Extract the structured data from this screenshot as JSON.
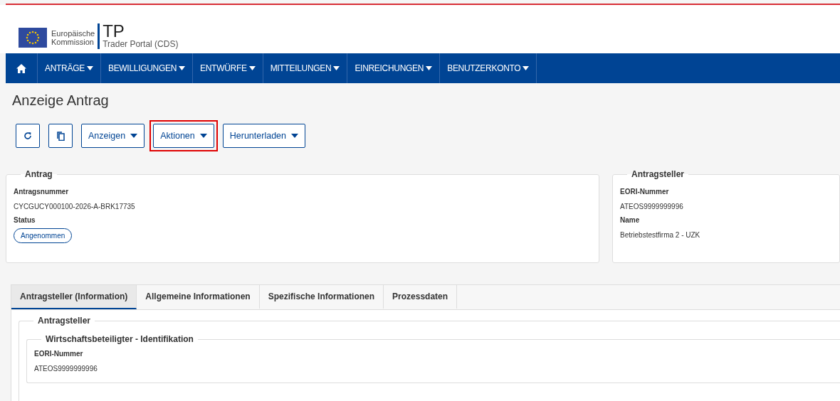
{
  "header": {
    "logo_line_1": "Europäische",
    "logo_line_2": "Kommission",
    "app_name": "TP",
    "app_subtitle": "Trader Portal (CDS)"
  },
  "nav": [
    {
      "label": "ANTRÄGE",
      "kind": "dropdown"
    },
    {
      "label": "BEWILLIGUNGEN",
      "kind": "dropdown"
    },
    {
      "label": "ENTWÜRFE",
      "kind": "dropdown"
    },
    {
      "label": "MITTEILUNGEN",
      "kind": "dropdown"
    },
    {
      "label": "EINREICHUNGEN",
      "kind": "dropdown"
    },
    {
      "label": "BENUTZERKONTO",
      "kind": "dropdown"
    }
  ],
  "page_title": "Anzeige Antrag",
  "toolbar": [
    {
      "kind": "refresh",
      "highlighted": false
    },
    {
      "kind": "copy",
      "highlighted": false
    },
    {
      "kind": "dropdown",
      "label": "Anzeigen",
      "highlighted": false
    },
    {
      "kind": "dropdown",
      "label": "Aktionen",
      "highlighted": true
    },
    {
      "kind": "dropdown",
      "label": "Herunterladen",
      "highlighted": false
    }
  ],
  "application_panel": {
    "title": "Antrag",
    "fields": [
      {
        "label": "Antragsnummer",
        "value": "CYCGUCY000100-2026-A-BRK17735",
        "kind": "text"
      },
      {
        "label": "Status",
        "value": "Angenommen",
        "kind": "badge"
      }
    ]
  },
  "applicant_panel": {
    "title": "Antragsteller",
    "fields": [
      {
        "label": "EORI-Nummer",
        "value": "ATEOS9999999996"
      },
      {
        "label": "Name",
        "value": "Betriebstestfirma 2 - UZK"
      }
    ]
  },
  "tabs": [
    {
      "label": "Antragsteller (Information)",
      "selected": true
    },
    {
      "label": "Allgemeine Informationen",
      "selected": false
    },
    {
      "label": "Spezifische Informationen",
      "selected": false
    },
    {
      "label": "Prozessdaten",
      "selected": false
    }
  ],
  "tab_content": {
    "section_title": "Antragsteller",
    "subsection_title": "Wirtschaftsbeteiligter - Identifikation",
    "fields": [
      {
        "label": "EORI-Nummer",
        "value": "ATEOS9999999996"
      }
    ]
  }
}
